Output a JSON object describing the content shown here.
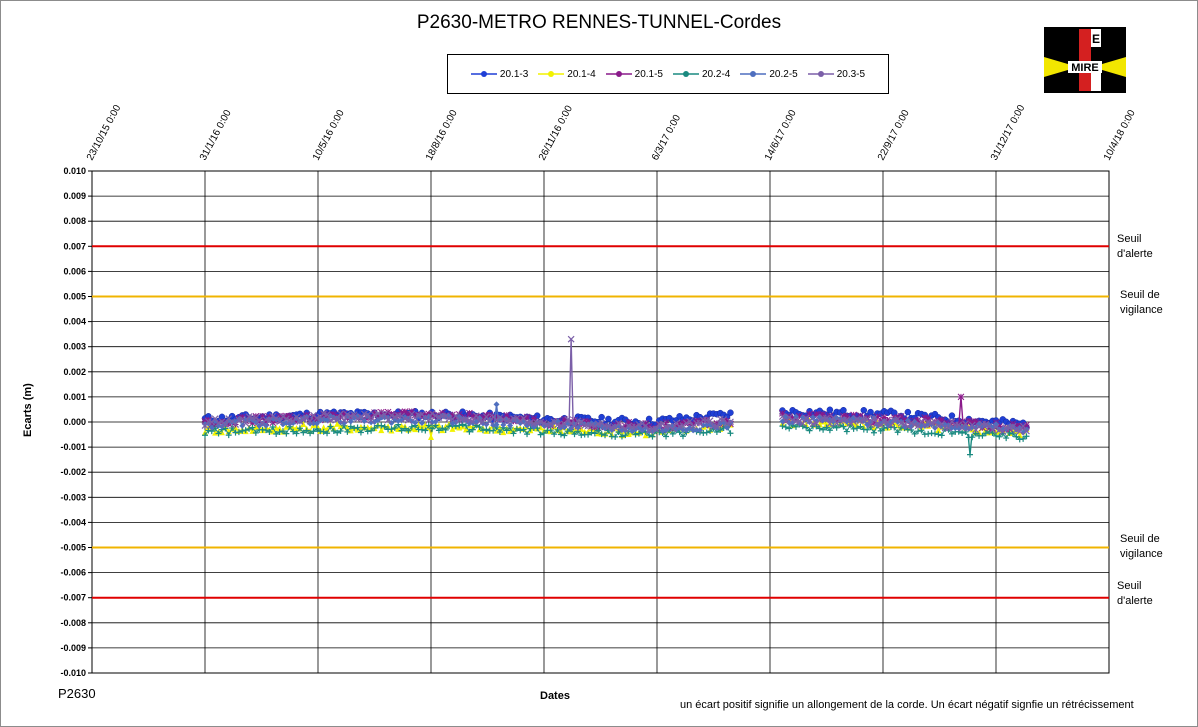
{
  "header": {
    "title": "P2630-METRO  RENNES-TUNNEL-Cordes"
  },
  "legend": [
    {
      "label": "20.1-3",
      "color": "#1f3fd6",
      "marker": "circle"
    },
    {
      "label": "20.1-4",
      "color": "#f2f200",
      "marker": "triangle"
    },
    {
      "label": "20.1-5",
      "color": "#8a1a8a",
      "marker": "star"
    },
    {
      "label": "20.2-4",
      "color": "#1a8a80",
      "marker": "plus"
    },
    {
      "label": "20.2-5",
      "color": "#4f6fbf",
      "marker": "diamond"
    },
    {
      "label": "20.3-5",
      "color": "#7b5fa8",
      "marker": "cross"
    }
  ],
  "logo": {
    "text": "MIRE",
    "letter": "E"
  },
  "thresholds": [
    {
      "label": [
        "Seuil",
        "d'alerte"
      ],
      "value": 0.007,
      "color": "#e00000"
    },
    {
      "label": [
        "Seuil de",
        "vigilance"
      ],
      "value": 0.005,
      "color": "#f0b400"
    },
    {
      "label": [
        "Seuil de",
        "vigilance"
      ],
      "value": -0.005,
      "color": "#f0b400"
    },
    {
      "label": [
        "Seuil",
        "d'alerte"
      ],
      "value": -0.007,
      "color": "#e00000"
    }
  ],
  "footer": {
    "plot_name": "P2630",
    "note": "un écart positif signifie un allongement de la corde.  Un écart négatif signfie  un rétrécissement"
  },
  "chart_data": {
    "type": "scatter",
    "title": "P2630-METRO  RENNES-TUNNEL-Cordes",
    "xlabel": "Dates",
    "ylabel": "Ecarts (m)",
    "x_ticks": [
      "23/10/15 0:00",
      "31/1/16 0:00",
      "10/5/16 0:00",
      "18/8/16 0:00",
      "26/11/16 0:00",
      "6/3/17 0:00",
      "14/6/17 0:00",
      "22/9/17 0:00",
      "31/12/17 0:00",
      "10/4/18 0:00"
    ],
    "xlim": [
      "2015-10-23",
      "2018-04-10"
    ],
    "ylim": [
      -0.01,
      0.01
    ],
    "y_ticks": [
      "0.010",
      "0.009",
      "0.008",
      "0.007",
      "0.006",
      "0.005",
      "0.004",
      "0.003",
      "0.002",
      "0.001",
      "0.000",
      "-0.001",
      "-0.002",
      "-0.003",
      "-0.004",
      "-0.005",
      "-0.006",
      "-0.007",
      "-0.008",
      "-0.009",
      "-0.010"
    ],
    "grid": true,
    "legend_position": "top-center",
    "measurement_periods": [
      [
        "2016-01-31",
        "2017-05-10"
      ],
      [
        "2017-06-25",
        "2018-01-28"
      ]
    ],
    "series": [
      {
        "name": "20.1-3",
        "trend": [
          [
            "2016-01-31",
            0.0001
          ],
          [
            "2016-05-20",
            0.0003
          ],
          [
            "2016-09-01",
            0.0003
          ],
          [
            "2016-12-01",
            0.0001
          ],
          [
            "2017-03-01",
            0.0
          ],
          [
            "2017-05-10",
            0.0003
          ],
          [
            "2017-06-25",
            0.0004
          ],
          [
            "2017-10-01",
            0.0003
          ],
          [
            "2018-01-28",
            -0.0001
          ]
        ],
        "spikes": []
      },
      {
        "name": "20.1-4",
        "trend": [
          [
            "2016-01-31",
            -0.0003
          ],
          [
            "2016-05-20",
            -0.0002
          ],
          [
            "2016-09-01",
            -0.0002
          ],
          [
            "2016-12-01",
            -0.0003
          ],
          [
            "2017-03-01",
            -0.0004
          ],
          [
            "2017-05-10",
            -0.0001
          ],
          [
            "2017-06-25",
            0.0
          ],
          [
            "2017-10-01",
            -0.0001
          ],
          [
            "2018-01-28",
            -0.0004
          ]
        ],
        "spikes": [
          [
            "2016-08-18",
            -0.0006
          ]
        ]
      },
      {
        "name": "20.1-5",
        "trend": [
          [
            "2016-01-31",
            0.0
          ],
          [
            "2016-05-20",
            0.0002
          ],
          [
            "2016-09-01",
            0.0003
          ],
          [
            "2016-12-01",
            0.0
          ],
          [
            "2017-03-01",
            -0.0002
          ],
          [
            "2017-05-10",
            0.0
          ],
          [
            "2017-06-25",
            0.0002
          ],
          [
            "2017-10-01",
            0.0001
          ],
          [
            "2018-01-28",
            -0.0002
          ]
        ],
        "spikes": [
          [
            "2017-11-30",
            0.001
          ]
        ]
      },
      {
        "name": "20.2-4",
        "trend": [
          [
            "2016-01-31",
            -0.0004
          ],
          [
            "2016-05-20",
            -0.0003
          ],
          [
            "2016-09-01",
            -0.0002
          ],
          [
            "2016-12-01",
            -0.0004
          ],
          [
            "2017-03-01",
            -0.0005
          ],
          [
            "2017-05-10",
            -0.0003
          ],
          [
            "2017-06-25",
            -0.0002
          ],
          [
            "2017-10-01",
            -0.0003
          ],
          [
            "2018-01-28",
            -0.0006
          ]
        ],
        "spikes": [
          [
            "2017-12-08",
            -0.0013
          ]
        ]
      },
      {
        "name": "20.2-5",
        "trend": [
          [
            "2016-01-31",
            -0.0001
          ],
          [
            "2016-05-20",
            0.0001
          ],
          [
            "2016-09-01",
            0.0001
          ],
          [
            "2016-12-01",
            -0.0001
          ],
          [
            "2017-03-01",
            -0.0003
          ],
          [
            "2017-05-10",
            -0.0001
          ],
          [
            "2017-06-25",
            0.0001
          ],
          [
            "2017-10-01",
            0.0
          ],
          [
            "2018-01-28",
            -0.0003
          ]
        ],
        "spikes": [
          [
            "2016-10-15",
            0.0007
          ]
        ]
      },
      {
        "name": "20.3-5",
        "trend": [
          [
            "2016-01-31",
            0.0
          ],
          [
            "2016-05-20",
            0.0002
          ],
          [
            "2016-09-01",
            0.0002
          ],
          [
            "2016-12-01",
            0.0
          ],
          [
            "2017-03-01",
            -0.0002
          ],
          [
            "2017-05-10",
            0.0
          ],
          [
            "2017-06-25",
            0.0001
          ],
          [
            "2017-10-01",
            0.0
          ],
          [
            "2018-01-28",
            -0.0003
          ]
        ],
        "spikes": [
          [
            "2016-12-20",
            0.0033
          ]
        ]
      }
    ]
  }
}
